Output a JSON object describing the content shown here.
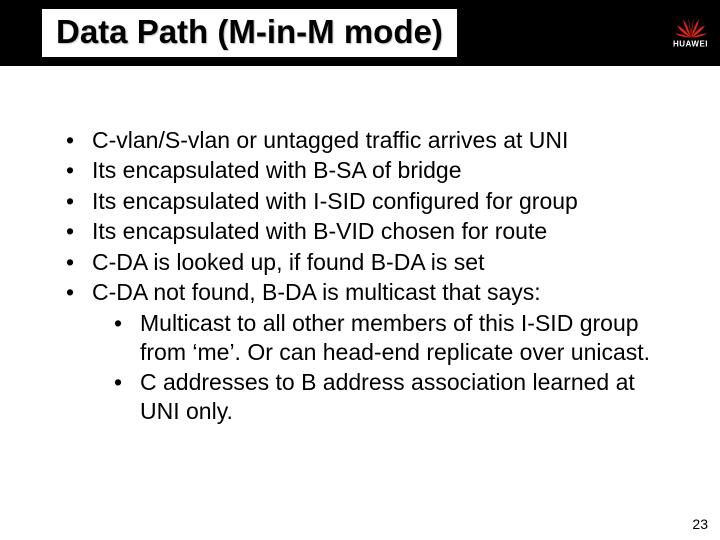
{
  "title": "Data Path (M-in-M mode)",
  "logo_text": "HUAWEI",
  "bullets": {
    "b0": "C-vlan/S-vlan or untagged traffic arrives at UNI",
    "b1": "Its encapsulated with B-SA of bridge",
    "b2": "Its encapsulated with I-SID configured for group",
    "b3": "Its encapsulated with B-VID chosen for route",
    "b4": "C-DA is looked up, if found B-DA is set",
    "b5": "C-DA not found, B-DA is multicast that says:",
    "b5_sub": {
      "s0": "Multicast to all other members of this I-SID group from ‘me’. Or can head-end replicate over unicast.",
      "s1": "C addresses to B address association learned at UNI only."
    }
  },
  "page_number": "23"
}
